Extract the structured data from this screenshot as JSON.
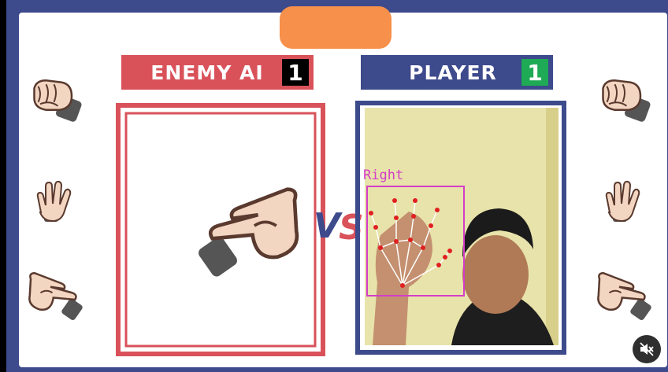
{
  "enemy": {
    "name": "ENEMY AI",
    "score": "1"
  },
  "player": {
    "name": "PLAYER",
    "score": "1"
  },
  "versus": "VS",
  "tracking": {
    "hand_label": "Right"
  },
  "enemy_move_icon": "peace-sign-hand-icon",
  "side_icons": {
    "left": [
      "fist-hand-icon",
      "open-palm-hand-icon",
      "peace-sign-hand-icon"
    ],
    "right": [
      "fist-hand-icon",
      "open-palm-hand-icon",
      "peace-sign-hand-icon"
    ]
  },
  "colors": {
    "enemy": "#d9525a",
    "player": "#3d4a8c",
    "timer": "#f7904a",
    "enemy_score_bg": "#000000",
    "player_score_bg": "#1faa55",
    "tracking": "#d43dc8",
    "landmark": "#e02020"
  }
}
